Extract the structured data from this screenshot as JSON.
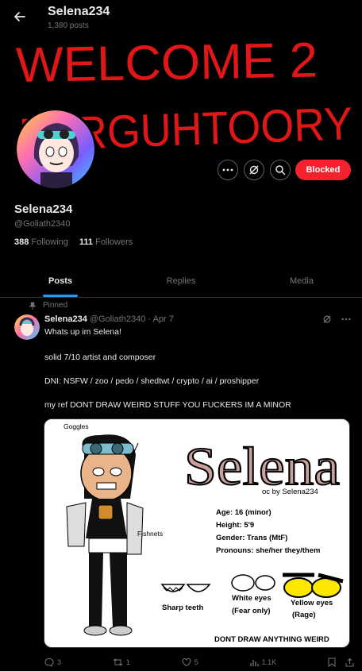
{
  "header": {
    "name": "Selena234",
    "post_count": "1,380 posts"
  },
  "banner": {
    "line1": "WELCOME 2",
    "line2": "BERGUHTOORY",
    "color": "#e11616"
  },
  "profile": {
    "display_name": "Selena234",
    "handle": "@Goliath2340",
    "following_count": "388",
    "following_label": "Following",
    "followers_count": "111",
    "followers_label": "Followers",
    "blocked_label": "Blocked",
    "blocked_color": "#f4212e"
  },
  "tabs": [
    {
      "label": "Posts",
      "active": true
    },
    {
      "label": "Replies",
      "active": false
    },
    {
      "label": "Media",
      "active": false
    }
  ],
  "accent": "#1d9bf0",
  "post": {
    "pinned_label": "Pinned",
    "author": "Selena234",
    "handle": "@Goliath2340",
    "date": "· Apr 7",
    "lines": [
      "Whats up im Selena!",
      "solid 7/10 artist and composer",
      "DNI: NSFW / zoo / pedo / shedtwt / crypto / ai / proshipper",
      "my ref DONT DRAW WEIRD STUFF YOU FUCKERS IM A MINOR"
    ],
    "ref_sheet": {
      "title": "Selena",
      "byline": "oc by Selena234",
      "goggles": "Goggles",
      "fishnets": "Fishnets",
      "sharp_teeth": "Sharp teeth",
      "white_eyes": "White eyes",
      "white_eyes_note": "(Fear only)",
      "yellow_eyes": "Yellow eyes",
      "yellow_eyes_note": "(Rage)",
      "age": "Age: 16 (minor)",
      "height": "Height: 5'9",
      "gender": "Gender: Trans (MtF)",
      "pronouns": "Pronouns: she/her they/them",
      "warning": "DONT DRAW ANYTHING WEIRD"
    },
    "stats": {
      "replies": "3",
      "reposts": "1",
      "likes": "5",
      "views": "1.1K"
    }
  }
}
